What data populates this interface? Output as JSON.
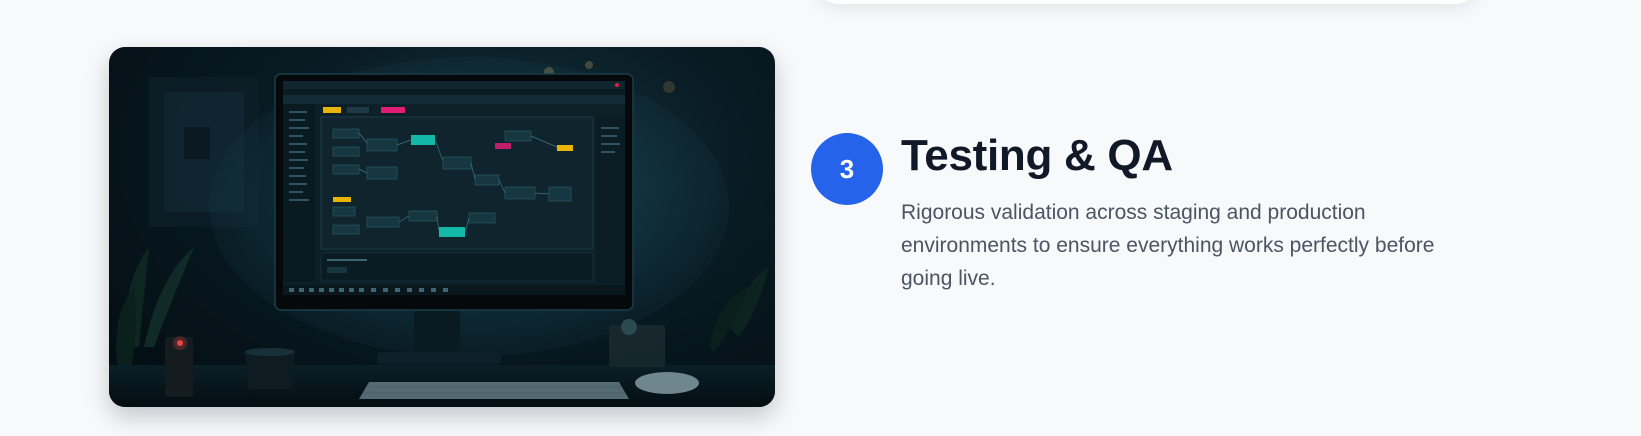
{
  "step": {
    "number": "3",
    "title": "Testing & QA",
    "description": "Rigorous validation across staging and production environments to ensure everything works perfectly before going live."
  },
  "photo": {
    "subject": "desktop-monitor-workflow-editor",
    "accent_color": "#2563eb",
    "screen_node_colors": [
      "#14b8a6",
      "#e11d74",
      "#eab308"
    ]
  },
  "colors": {
    "page_background": "#f7f9fb",
    "title": "#111827",
    "body_text": "#4b5563",
    "badge": "#2563eb"
  }
}
